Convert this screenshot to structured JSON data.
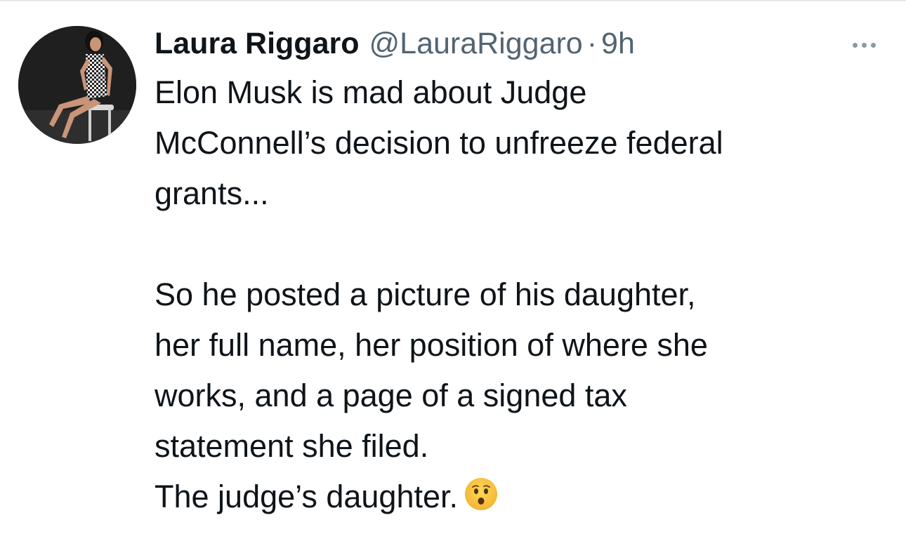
{
  "tweet": {
    "author": {
      "display_name": "Laura Riggaro",
      "handle": "@LauraRiggaro",
      "avatar_icon": "profile-photo-avatar"
    },
    "separator": "·",
    "timestamp": "9h",
    "more_icon": "more-horizontal-icon",
    "text_lines": [
      "Elon Musk is mad about Judge",
      "McConnell’s decision to unfreeze federal",
      "grants...",
      "",
      "So he posted a picture of his daughter,",
      "her full name, her position of where she",
      "works, and a page of a signed tax",
      "statement she filed.",
      "The judge’s daughter."
    ],
    "emoji": {
      "name": "hushed-face-emoji"
    }
  },
  "colors": {
    "text_primary": "#0f1419",
    "text_secondary": "#536471",
    "background": "#ffffff",
    "emoji_yellow": "#f7c33c"
  }
}
